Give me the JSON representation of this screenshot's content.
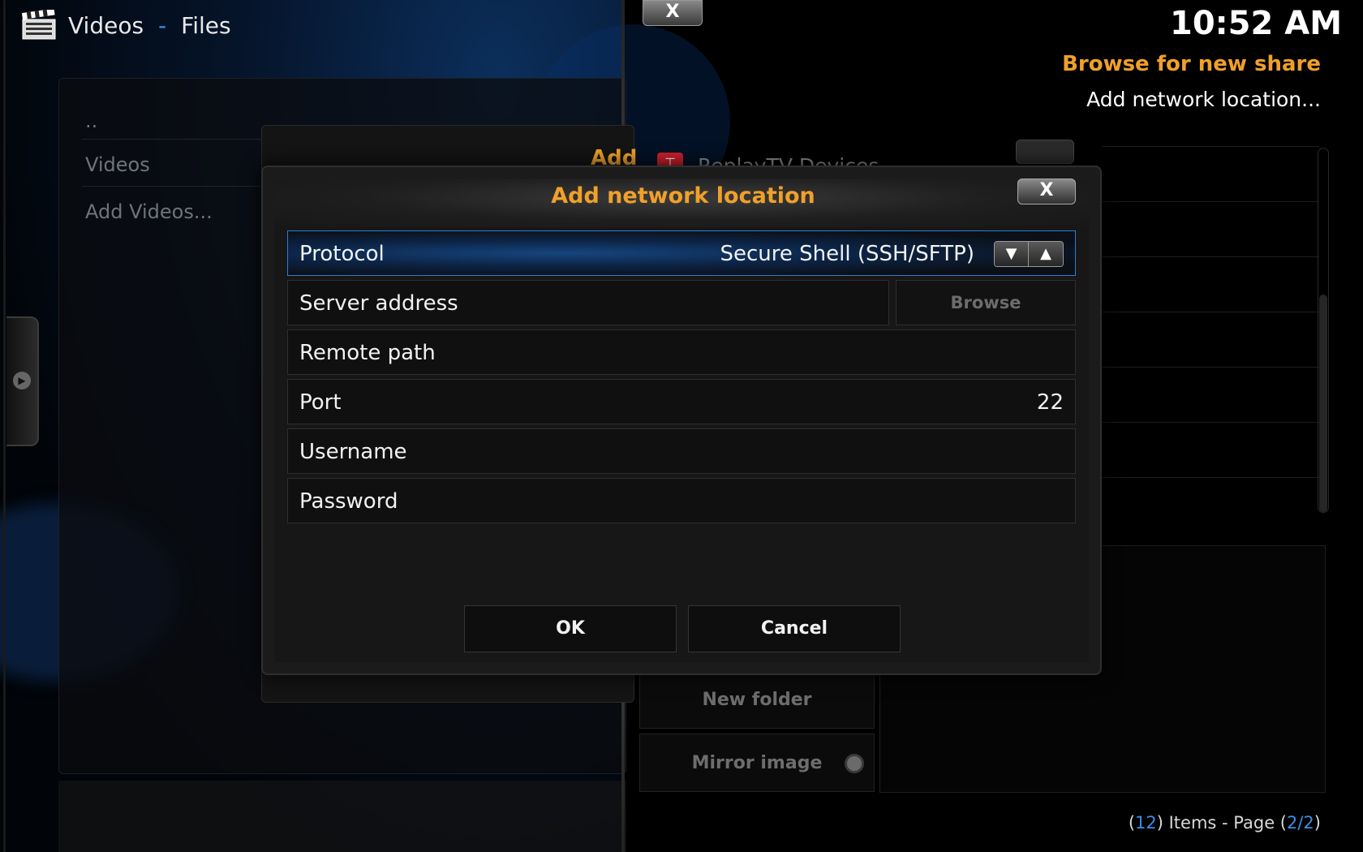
{
  "header": {
    "section": "Videos",
    "separator": "-",
    "subsection": "Files",
    "clock": "10:52 AM"
  },
  "context": {
    "title": "Browse for new share",
    "subtitle": "Add network location..."
  },
  "file_list": {
    "items": [
      "..",
      "Videos",
      "Add Videos..."
    ]
  },
  "background_dialog": {
    "title_fragment": "Add",
    "source_name": "ReplayTV Devices"
  },
  "side_buttons": {
    "new_folder": "New folder",
    "mirror_image": "Mirror image"
  },
  "items_info": {
    "open_paren": "(",
    "count": "12",
    "mid_text": ") Items - Page (",
    "page": "2/2",
    "close_paren": ")"
  },
  "dialog": {
    "title": "Add network location",
    "close_label": "X",
    "fields": {
      "protocol": {
        "label": "Protocol",
        "value": "Secure Shell (SSH/SFTP)"
      },
      "server_address": {
        "label": "Server address",
        "browse_label": "Browse"
      },
      "remote_path": {
        "label": "Remote path"
      },
      "port": {
        "label": "Port",
        "value": "22"
      },
      "username": {
        "label": "Username"
      },
      "password": {
        "label": "Password"
      }
    },
    "ok_label": "OK",
    "cancel_label": "Cancel"
  },
  "top_close_label": "X"
}
